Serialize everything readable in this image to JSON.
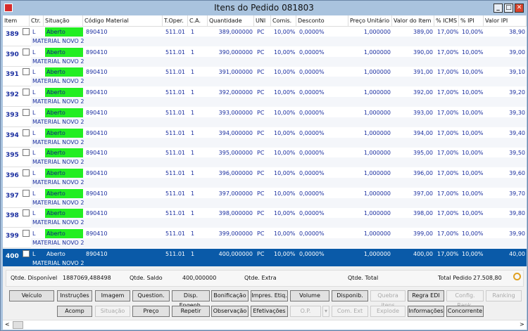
{
  "window": {
    "title": "Itens do Pedido 081803",
    "minimize": "_",
    "maximize": "□",
    "close": "✕"
  },
  "columns": [
    "Item",
    "Ctr.",
    "Situação",
    "Código Material",
    "T.Oper.",
    "C.A.",
    "Quantidade",
    "UNI",
    "Comis.",
    "Desconto",
    "Preço Unitário",
    "Valor do Item",
    "% ICMS",
    "% IPI",
    "Valor IPI"
  ],
  "rows": [
    {
      "item": "389",
      "ctr": "L",
      "situacao": "Aberto",
      "codigo": "890410",
      "toper": "511.01",
      "ca": "1",
      "qtd": "389,000000",
      "uni": "PC",
      "comis": "10,00%",
      "desc": "0,0000%",
      "preco": "1,000000",
      "valor": "389,00",
      "icms": "17,00%",
      "ipi": "10,00%",
      "vipi": "38,90",
      "material": "MATERIAL NOVO 2"
    },
    {
      "item": "390",
      "ctr": "L",
      "situacao": "Aberto",
      "codigo": "890410",
      "toper": "511.01",
      "ca": "1",
      "qtd": "390,000000",
      "uni": "PC",
      "comis": "10,00%",
      "desc": "0,0000%",
      "preco": "1,000000",
      "valor": "390,00",
      "icms": "17,00%",
      "ipi": "10,00%",
      "vipi": "39,00",
      "material": "MATERIAL NOVO 2"
    },
    {
      "item": "391",
      "ctr": "L",
      "situacao": "Aberto",
      "codigo": "890410",
      "toper": "511.01",
      "ca": "1",
      "qtd": "391,000000",
      "uni": "PC",
      "comis": "10,00%",
      "desc": "0,0000%",
      "preco": "1,000000",
      "valor": "391,00",
      "icms": "17,00%",
      "ipi": "10,00%",
      "vipi": "39,10",
      "material": "MATERIAL NOVO 2"
    },
    {
      "item": "392",
      "ctr": "L",
      "situacao": "Aberto",
      "codigo": "890410",
      "toper": "511.01",
      "ca": "1",
      "qtd": "392,000000",
      "uni": "PC",
      "comis": "10,00%",
      "desc": "0,0000%",
      "preco": "1,000000",
      "valor": "392,00",
      "icms": "17,00%",
      "ipi": "10,00%",
      "vipi": "39,20",
      "material": "MATERIAL NOVO 2"
    },
    {
      "item": "393",
      "ctr": "L",
      "situacao": "Aberto",
      "codigo": "890410",
      "toper": "511.01",
      "ca": "1",
      "qtd": "393,000000",
      "uni": "PC",
      "comis": "10,00%",
      "desc": "0,0000%",
      "preco": "1,000000",
      "valor": "393,00",
      "icms": "17,00%",
      "ipi": "10,00%",
      "vipi": "39,30",
      "material": "MATERIAL NOVO 2"
    },
    {
      "item": "394",
      "ctr": "L",
      "situacao": "Aberto",
      "codigo": "890410",
      "toper": "511.01",
      "ca": "1",
      "qtd": "394,000000",
      "uni": "PC",
      "comis": "10,00%",
      "desc": "0,0000%",
      "preco": "1,000000",
      "valor": "394,00",
      "icms": "17,00%",
      "ipi": "10,00%",
      "vipi": "39,40",
      "material": "MATERIAL NOVO 2"
    },
    {
      "item": "395",
      "ctr": "L",
      "situacao": "Aberto",
      "codigo": "890410",
      "toper": "511.01",
      "ca": "1",
      "qtd": "395,000000",
      "uni": "PC",
      "comis": "10,00%",
      "desc": "0,0000%",
      "preco": "1,000000",
      "valor": "395,00",
      "icms": "17,00%",
      "ipi": "10,00%",
      "vipi": "39,50",
      "material": "MATERIAL NOVO 2"
    },
    {
      "item": "396",
      "ctr": "L",
      "situacao": "Aberto",
      "codigo": "890410",
      "toper": "511.01",
      "ca": "1",
      "qtd": "396,000000",
      "uni": "PC",
      "comis": "10,00%",
      "desc": "0,0000%",
      "preco": "1,000000",
      "valor": "396,00",
      "icms": "17,00%",
      "ipi": "10,00%",
      "vipi": "39,60",
      "material": "MATERIAL NOVO 2"
    },
    {
      "item": "397",
      "ctr": "L",
      "situacao": "Aberto",
      "codigo": "890410",
      "toper": "511.01",
      "ca": "1",
      "qtd": "397,000000",
      "uni": "PC",
      "comis": "10,00%",
      "desc": "0,0000%",
      "preco": "1,000000",
      "valor": "397,00",
      "icms": "17,00%",
      "ipi": "10,00%",
      "vipi": "39,70",
      "material": "MATERIAL NOVO 2"
    },
    {
      "item": "398",
      "ctr": "L",
      "situacao": "Aberto",
      "codigo": "890410",
      "toper": "511.01",
      "ca": "1",
      "qtd": "398,000000",
      "uni": "PC",
      "comis": "10,00%",
      "desc": "0,0000%",
      "preco": "1,000000",
      "valor": "398,00",
      "icms": "17,00%",
      "ipi": "10,00%",
      "vipi": "39,80",
      "material": "MATERIAL NOVO 2"
    },
    {
      "item": "399",
      "ctr": "L",
      "situacao": "Aberto",
      "codigo": "890410",
      "toper": "511.01",
      "ca": "1",
      "qtd": "399,000000",
      "uni": "PC",
      "comis": "10,00%",
      "desc": "0,0000%",
      "preco": "1,000000",
      "valor": "399,00",
      "icms": "17,00%",
      "ipi": "10,00%",
      "vipi": "39,90",
      "material": "MATERIAL NOVO 2"
    },
    {
      "item": "400",
      "ctr": "L",
      "situacao": "Aberto",
      "codigo": "890410",
      "toper": "511.01",
      "ca": "1",
      "qtd": "400,000000",
      "uni": "PC",
      "comis": "10,00%",
      "desc": "0,0000%",
      "preco": "1,000000",
      "valor": "400,00",
      "icms": "17,00%",
      "ipi": "10,00%",
      "vipi": "40,00",
      "material": "MATERIAL NOVO 2",
      "selected": true
    }
  ],
  "summary": {
    "disp_label": "Qtde. Disponível",
    "disp_value": "1887069,488498",
    "saldo_label": "Qtde. Saldo",
    "saldo_value": "400,000000",
    "extra_label": "Qtde. Extra",
    "total_label": "Qtde. Total",
    "pedido_label": "Total Pedido",
    "pedido_value": "27.508,80",
    "search_icon": "magnifier-icon"
  },
  "buttons_row1": [
    {
      "label": "Veículo",
      "enabled": true
    },
    {
      "label": "Instruções",
      "enabled": true
    },
    {
      "label": "Imagem",
      "enabled": true
    },
    {
      "label": "Question.",
      "enabled": true
    },
    {
      "label": "Disp. Engenh.",
      "enabled": true
    },
    {
      "label": "Bonificação",
      "enabled": true
    },
    {
      "label": "Impres. Etiq.",
      "enabled": true
    },
    {
      "label": "Volume",
      "enabled": true
    },
    {
      "label": "Disponib.",
      "enabled": true
    },
    {
      "label": "Quebra itens",
      "enabled": false
    },
    {
      "label": "Regra EDI",
      "enabled": true
    },
    {
      "label": "Config. Rank.",
      "enabled": false
    },
    {
      "label": "Ranking",
      "enabled": false
    }
  ],
  "buttons_row2": [
    {
      "label": "Acomp",
      "enabled": true
    },
    {
      "label": "Situação",
      "enabled": false
    },
    {
      "label": "Preço",
      "enabled": true
    },
    {
      "label": "Repetir",
      "enabled": true
    },
    {
      "label": "Observação",
      "enabled": true
    },
    {
      "label": "Efetivações",
      "enabled": true
    },
    {
      "label": "O.P.",
      "enabled": false
    },
    {
      "label": "▾",
      "enabled": false
    },
    {
      "label": "Com. Ext",
      "enabled": false
    },
    {
      "label": "Explode",
      "enabled": false
    },
    {
      "label": "Informações",
      "enabled": true
    },
    {
      "label": "Concorrente",
      "enabled": true
    }
  ],
  "scroll": {
    "left": "<",
    "right": ">"
  },
  "colors": {
    "status_green": "#22ee22",
    "selected_row": "#0a5aa8",
    "text_blue": "#1a2ea0"
  }
}
